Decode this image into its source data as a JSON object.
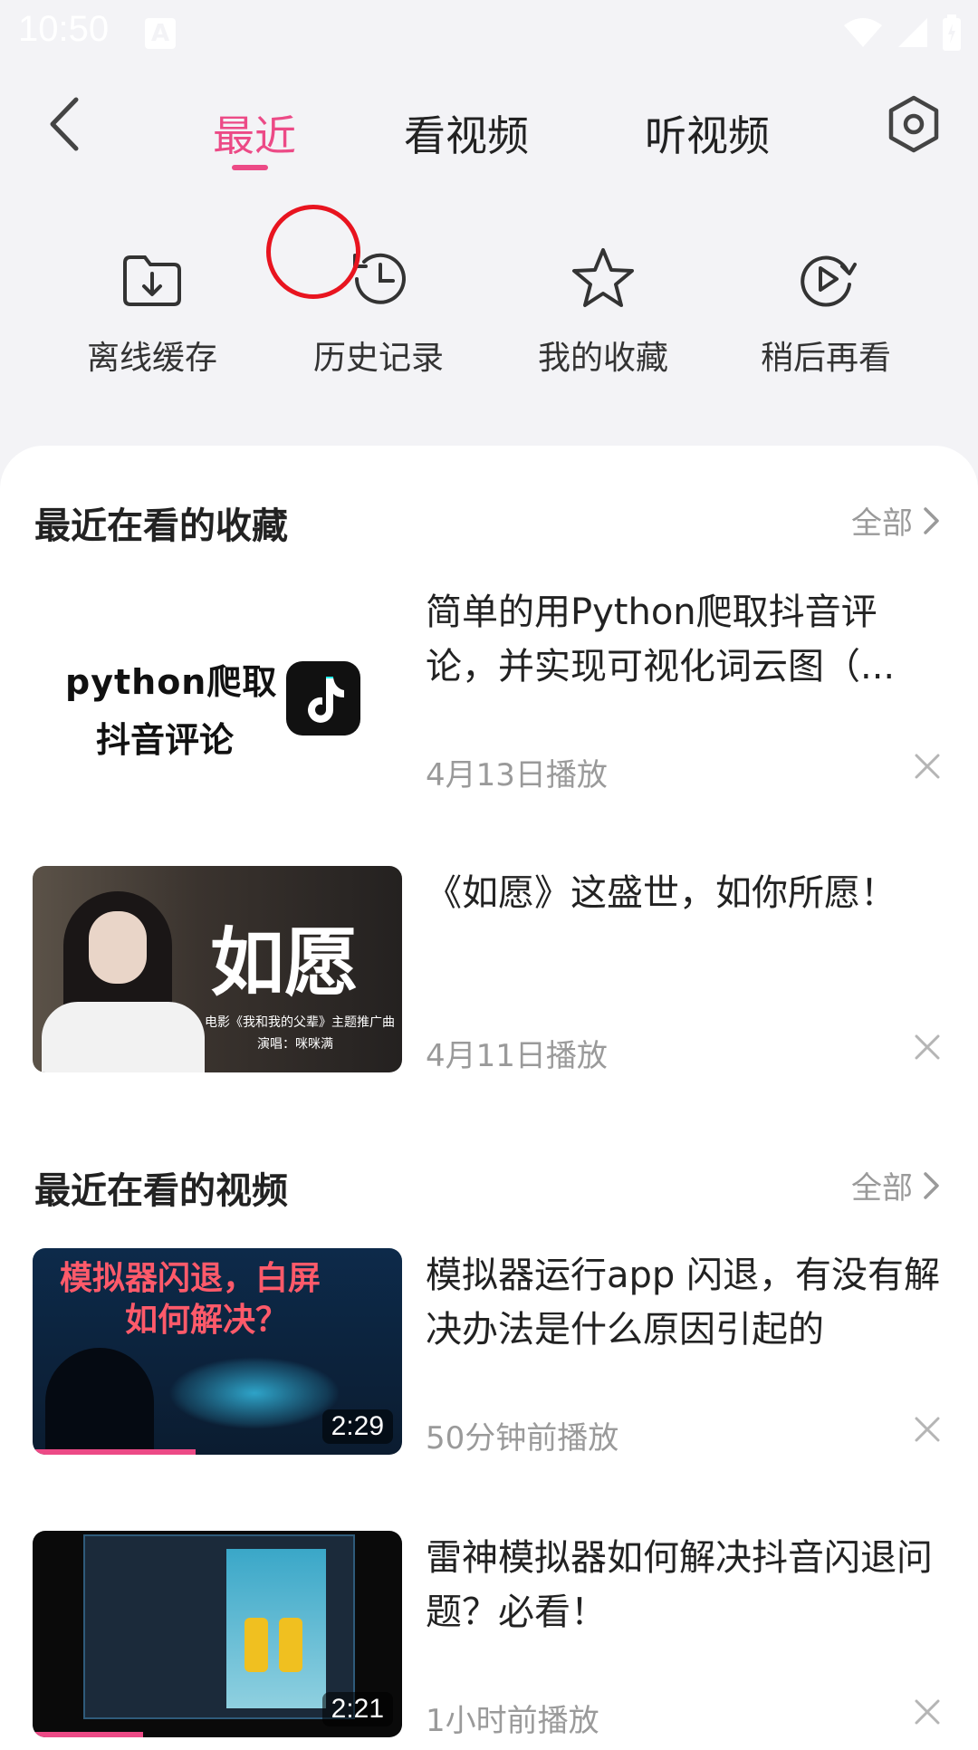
{
  "status": {
    "time": "10:50",
    "indicator": "A"
  },
  "nav": {
    "tabs": [
      {
        "label": "最近",
        "active": true
      },
      {
        "label": "看视频",
        "active": false
      },
      {
        "label": "听视频",
        "active": false
      }
    ]
  },
  "shortcuts": [
    {
      "label": "离线缓存",
      "icon": "download-folder-icon"
    },
    {
      "label": "历史记录",
      "icon": "history-clock-icon"
    },
    {
      "label": "我的收藏",
      "icon": "star-icon"
    },
    {
      "label": "稍后再看",
      "icon": "watch-later-icon"
    }
  ],
  "favorites": {
    "title": "最近在看的收藏",
    "more": "全部",
    "items": [
      {
        "title": "简单的用Python爬取抖音评论，并实现可视化词云图（...",
        "meta": "4月13日播放",
        "thumb_text": [
          "python爬取",
          "抖音评论"
        ]
      },
      {
        "title": "《如愿》这盛世，如你所愿！",
        "meta": "4月11日播放",
        "thumb_text": [
          "如愿",
          "电影《我和我的父辈》主题推广曲",
          "演唱：咪咪满"
        ]
      }
    ]
  },
  "videos": {
    "title": "最近在看的视频",
    "more": "全部",
    "items": [
      {
        "title": "模拟器运行app 闪退，有没有解决办法是什么原因引起的",
        "meta": "50分钟前播放",
        "duration": "2:29",
        "progress": 0.44,
        "thumb_text": [
          "模拟器闪退，白屏",
          "如何解决？"
        ]
      },
      {
        "title": "雷神模拟器如何解决抖音闪退问题？必看！",
        "meta": "1小时前播放",
        "duration": "2:21",
        "progress": 0.3
      }
    ]
  },
  "colors": {
    "accent": "#ec4a86",
    "background": "#f3f3f6",
    "card": "#ffffff",
    "muted": "#9a9a9a",
    "annotation": "#e8141f"
  }
}
